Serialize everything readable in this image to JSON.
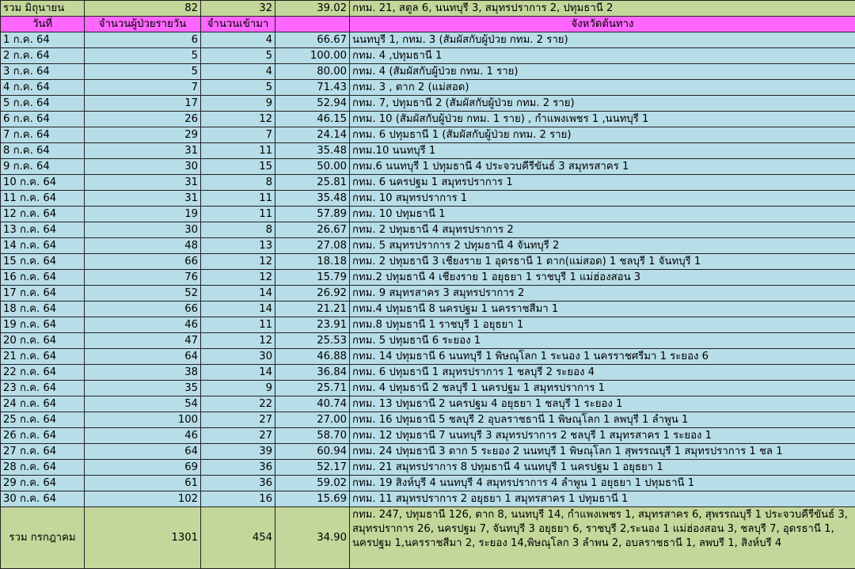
{
  "summary_june": {
    "label": "รวม มิถุนายน",
    "patients": "82",
    "admitted": "32",
    "percent": "39.02",
    "provinces": "กทม. 21, สตูล 6, นนทบุรี 3, สมุทรปราการ 2, ปทุมธานี 2"
  },
  "headers": {
    "date": "วันที่",
    "patients": "จำนวนผู้ป่วยรายวัน",
    "admitted": "จำนวนเข้ามา",
    "percent": "",
    "provinces": "จังหวัดต้นทาง"
  },
  "rows": [
    {
      "date": "1 ก.ค. 64",
      "patients": "6",
      "admitted": "4",
      "percent": "66.67",
      "provinces": "นนทบุรี 1, กทม. 3        (สัมผัสกับผู้ป่วย กทม. 2 ราย)"
    },
    {
      "date": "2 ก.ค. 64",
      "patients": "5",
      "admitted": "5",
      "percent": "100.00",
      "provinces": "กทม. 4 ,ปทุมธานี 1"
    },
    {
      "date": "3 ก.ค. 64",
      "patients": "5",
      "admitted": "4",
      "percent": "80.00",
      "provinces": "กทม. 4                                    (สัมผัสกับผู้ป่วย กทม. 1 ราย)"
    },
    {
      "date": "4 ก.ค. 64",
      "patients": "7",
      "admitted": "5",
      "percent": "71.43",
      "provinces": "กทม. 3 , ตาก 2 (แม่สอด)"
    },
    {
      "date": "5 ก.ค. 64",
      "patients": "17",
      "admitted": "9",
      "percent": "52.94",
      "provinces": "กทม. 7, ปทุมธานี 2      (สัมผัสกับผู้ป่วย กทม. 2 ราย)"
    },
    {
      "date": "6 ก.ค. 64",
      "patients": "26",
      "admitted": "12",
      "percent": "46.15",
      "provinces": "กทม. 10 (สัมผัสกับผู้ป่วย กทม. 1 ราย) , กำแพงเพชร 1 ,นนทบุรี 1"
    },
    {
      "date": "7 ก.ค. 64",
      "patients": "29",
      "admitted": "7",
      "percent": "24.14",
      "provinces": "กทม. 6 ปทุมธานี 1 (สัมผัสกับผู้ป่วย กทม. 2 ราย)"
    },
    {
      "date": "8 ก.ค. 64",
      "patients": "31",
      "admitted": "11",
      "percent": "35.48",
      "provinces": "กทม.10 นนทบุรี 1"
    },
    {
      "date": "9 ก.ค. 64",
      "patients": "30",
      "admitted": "15",
      "percent": "50.00",
      "provinces": "กทม.6 นนทบุรี 1 ปทุมธานี 4 ประจวบคีรีขันธ์ 3 สมุทรสาคร 1"
    },
    {
      "date": "10 ก.ค. 64",
      "patients": "31",
      "admitted": "8",
      "percent": "25.81",
      "provinces": "กทม. 6 นครปฐม 1 สมุทรปราการ 1"
    },
    {
      "date": "11 ก.ค. 64",
      "patients": "31",
      "admitted": "11",
      "percent": "35.48",
      "provinces": "กทม. 10 สมุทรปราการ 1"
    },
    {
      "date": "12 ก.ค. 64",
      "patients": "19",
      "admitted": "11",
      "percent": "57.89",
      "provinces": "กทม. 10 ปทุมธานี 1"
    },
    {
      "date": "13 ก.ค. 64",
      "patients": "30",
      "admitted": "8",
      "percent": "26.67",
      "provinces": "กทม. 2 ปทุมธานี 4 สมุทรปราการ 2"
    },
    {
      "date": "14 ก.ค. 64",
      "patients": "48",
      "admitted": "13",
      "percent": "27.08",
      "provinces": "กทม. 5 สมุทรปราการ 2 ปทุมธานี 4 จันทบุรี 2"
    },
    {
      "date": "15 ก.ค. 64",
      "patients": "66",
      "admitted": "12",
      "percent": "18.18",
      "provinces": "กทม. 2 ปทุมธานี 3 เชียงราย 1 อุดรธานี 1 ตาก(แม่สอด) 1 ชลบุรี 1 จันทบุรี 1"
    },
    {
      "date": "16 ก.ค. 64",
      "patients": "76",
      "admitted": "12",
      "percent": "15.79",
      "provinces": "กทม.2 ปทุมธานี 4 เชียงราย 1 อยุธยา 1 ราชบุรี 1 แม่ฮ่องสอน 3"
    },
    {
      "date": "17 ก.ค. 64",
      "patients": "52",
      "admitted": "14",
      "percent": "26.92",
      "provinces": "กทม. 9 สมุทรสาคร 3 สมุทรปราการ 2"
    },
    {
      "date": "18 ก.ค. 64",
      "patients": "66",
      "admitted": "14",
      "percent": "21.21",
      "provinces": "กทม.4 ปทุมธานี 8 นครปฐม 1 นครราชสีมา 1"
    },
    {
      "date": "19 ก.ค. 64",
      "patients": "46",
      "admitted": "11",
      "percent": "23.91",
      "provinces": "กทม.8 ปทุมธานี 1 ราชบุรี 1 อยุธยา 1"
    },
    {
      "date": "20 ก.ค. 64",
      "patients": "47",
      "admitted": "12",
      "percent": "25.53",
      "provinces": "กทม. 5 ปทุมธานี 6 ระยอง 1"
    },
    {
      "date": "21 ก.ค. 64",
      "patients": "64",
      "admitted": "30",
      "percent": "46.88",
      "provinces": "กทม. 14 ปทุมธานี 6 นนทบุรี 1 พิษณุโลก 1 ระนอง 1 นครราชศรีมา 1 ระยอง 6"
    },
    {
      "date": "22 ก.ค. 64",
      "patients": "38",
      "admitted": "14",
      "percent": "36.84",
      "provinces": "กทม. 6 ปทุมธานี 1 สมุทรปราการ 1 ชลบุรี 2 ระยอง 4"
    },
    {
      "date": "23 ก.ค. 64",
      "patients": "35",
      "admitted": "9",
      "percent": "25.71",
      "provinces": "กทม. 4 ปทุมธานี 2 ชลบุรี 1 นครปฐม 1 สมุทรปราการ 1"
    },
    {
      "date": "24 ก.ค. 64",
      "patients": "54",
      "admitted": "22",
      "percent": "40.74",
      "provinces": "กทม. 13 ปทุมธานี 2 นครปฐม 4 อยุธยา 1 ชลบุรี 1 ระยอง 1"
    },
    {
      "date": "25 ก.ค. 64",
      "patients": "100",
      "admitted": "27",
      "percent": "27.00",
      "provinces": "กทม. 16 ปทุมธานี 5 ชลบุรี 2 อุบลราชธานี 1 พิษณุโลก 1 ลพบุรี 1 ลำพูน 1"
    },
    {
      "date": "26 ก.ค. 64",
      "patients": "46",
      "admitted": "27",
      "percent": "58.70",
      "provinces": "กทม. 12 ปทุมธานี 7 นนทบุรี 3 สมุทรปราการ 2 ชลบุรี 1 สมุทรสาคร 1 ระยอง 1"
    },
    {
      "date": "27 ก.ค. 64",
      "patients": "64",
      "admitted": "39",
      "percent": "60.94",
      "provinces": "กทม. 24 ปทุมธานี 3 ตาก 5 ระยอง 2 นนทบุรี 1 พิษณุโลก 1 สุพรรณบุรี 1 สมุทรปราการ 1 ชล 1"
    },
    {
      "date": "28 ก.ค. 64",
      "patients": "69",
      "admitted": "36",
      "percent": "52.17",
      "provinces": "กทม. 21 สมุทรปราการ 8 ปทุมธานี 4 นนทบุรี 1 นครปฐม 1 อยุธยา 1"
    },
    {
      "date": "29 ก.ค. 64",
      "patients": "61",
      "admitted": "36",
      "percent": "59.02",
      "provinces": "กทม. 19 สิงห์บุรี 4 นนทบุรี 4 สมุทรปราการ 4 ลำพูน 1 อยุธยา 1 ปทุมธานี 1"
    },
    {
      "date": "30 ก.ค. 64",
      "patients": "102",
      "admitted": "16",
      "percent": "15.69",
      "provinces": "กทม. 11 สมุทรปราการ 2 อยุธยา 1 สมุทรสาคร 1 ปทุมธานี 1"
    }
  ],
  "summary_july": {
    "label": "รวม กรกฎาคม",
    "patients": "1301",
    "admitted": "454",
    "percent": "34.90",
    "provinces": "กทม. 247, ปทุมธานี 126, ตาก 8, นนทบุรี 14, กำแพงเพชร 1, สมุทรสาคร 6, สุพรรณบุรี 1 ประจวบคีรีขันธ์ 3, สมุทรปราการ 26, นครปฐม 7, จันทบุรี 3 อยุธยา 6, ราชบุรี 2,ระนอง 1 แม่ฮ่องสอน 3, ชลบุรี 7, อุดรธานี 1, นครปฐม 1,นครราชสีมา 2, ระยอง 14,พิษณุโลก 3 ลำพน 2, อบลราชธานี 1, ลพบรี 1, สิงห์บรี 4"
  },
  "colors": {
    "summary_bg": "#c4d79b",
    "header_bg": "#ff66ff",
    "row_bg": "#b7dde8",
    "grid": "#222222"
  }
}
